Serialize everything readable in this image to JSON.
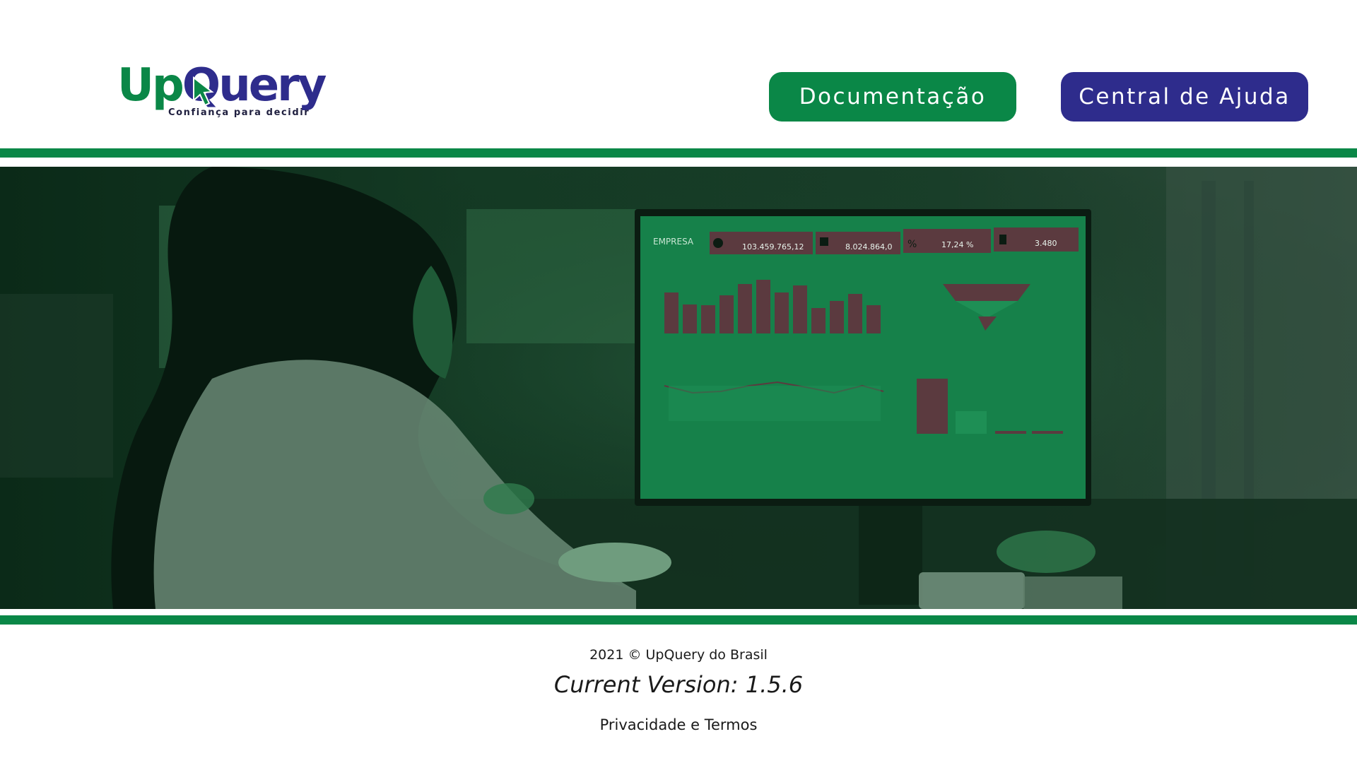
{
  "header": {
    "logo": {
      "text_up": "Up",
      "text_query": "Query",
      "tagline": "Confiança para decidir"
    },
    "buttons": {
      "documentation": "Documentação",
      "help_center": "Central de Ajuda"
    }
  },
  "hero": {
    "icon": "person-at-computer-dashboard-image",
    "screen": {
      "company_label": "EMPRESA",
      "kpis": [
        "103.459.765,12",
        "8.024.864,0",
        "17,24 %",
        "3.480"
      ],
      "kpi_icons": [
        "dollar-icon",
        "weight-icon",
        "percent-icon",
        "document-icon"
      ]
    }
  },
  "footer": {
    "copyright": "2021 © UpQuery do Brasil",
    "version": "Current Version: 1.5.6",
    "privacy": "Privacidade e Termos"
  },
  "colors": {
    "brand_green": "#0a8747",
    "brand_navy": "#2e2c8c"
  }
}
